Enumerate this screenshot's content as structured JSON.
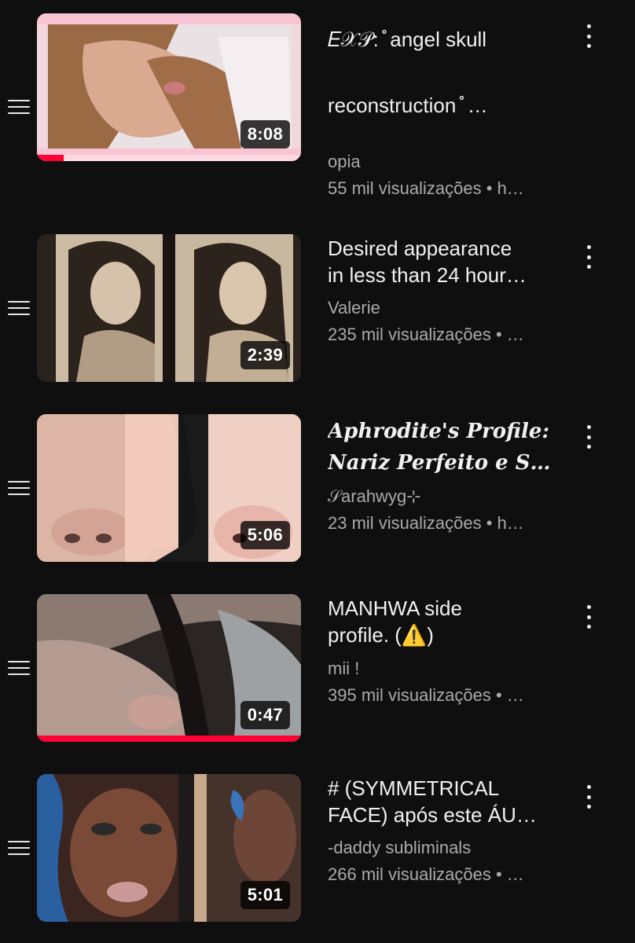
{
  "videos": [
    {
      "title_line1": "𝐸𝒳𝒫: ̊̊ angel skull",
      "title_line2": "reconstruction ̊̊ …",
      "channel": "opia",
      "stats": "55 mil visualizações • h…",
      "duration": "8:08",
      "watched_fraction": 0.1
    },
    {
      "title_line1": "Desired appearance",
      "title_line2": "in less than 24 hour…",
      "channel": "Valerie",
      "stats": "235 mil visualizações • …",
      "duration": "2:39",
      "watched_fraction": 0
    },
    {
      "title_line1": "Aphrodite's Profile:",
      "title_line2": "Nariz Perfeito e Simét…",
      "channel": "𝒮arahwyg⊹",
      "stats": "23 mil visualizações • h…",
      "duration": "5:06",
      "watched_fraction": 0
    },
    {
      "title_line1": "MANHWA side",
      "title_line2": "profile. (⚠️)",
      "channel": "mii !",
      "stats": "395 mil visualizações • …",
      "duration": "0:47",
      "watched_fraction": 1.0
    },
    {
      "title_line1": "# (SYMMETRICAL",
      "title_line2": "FACE) após este ÁU…",
      "channel": "-daddy subliminals",
      "stats": "266 mil visualizações • …",
      "duration": "5:01",
      "watched_fraction": 0
    }
  ],
  "icons": {
    "drag": "drag-handle-icon",
    "menu": "more-vert-icon"
  },
  "colors": {
    "background": "#0f0f0f",
    "progress": "#ff0033",
    "secondary_text": "#aaaaaa"
  }
}
